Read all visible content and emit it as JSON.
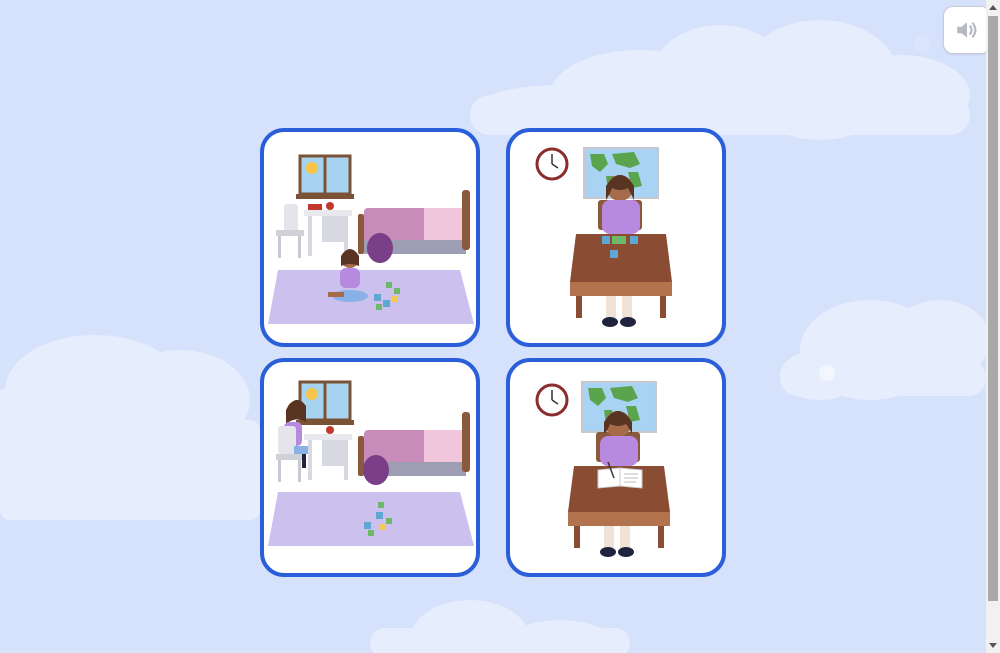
{
  "sound_button": {
    "icon": "speaker-icon",
    "state": "disabled"
  },
  "cards": [
    {
      "id": "bedroom-puzzle",
      "icon": "bedroom-girl-playing-puzzle-scene"
    },
    {
      "id": "classroom-puzzle",
      "icon": "classroom-girl-doing-puzzle-scene"
    },
    {
      "id": "bedroom-drawing",
      "icon": "bedroom-girl-at-desk-scene"
    },
    {
      "id": "classroom-writing",
      "icon": "classroom-girl-writing-scene"
    }
  ],
  "colors": {
    "background": "#d6e1fb",
    "card_border": "#2b5fd9",
    "clouds": "#e8eefc"
  }
}
